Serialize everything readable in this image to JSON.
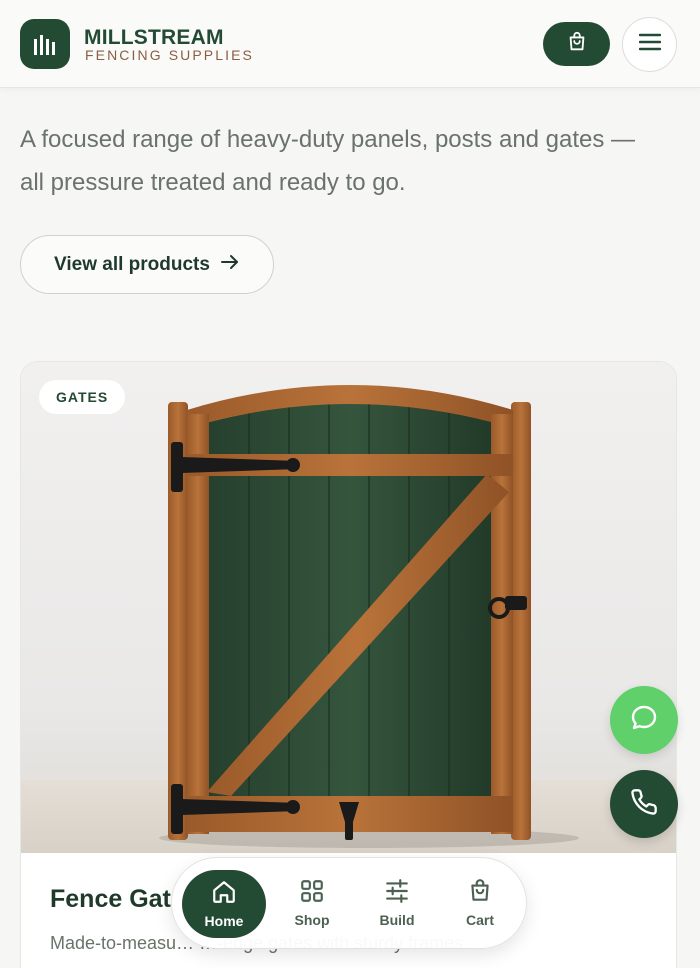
{
  "brand": {
    "name": "MILLSTREAM",
    "subtitle": "FENCING SUPPLIES"
  },
  "intro": {
    "text": "A focused range of heavy-duty panels, posts and gates — all pressure treated and ready to go.",
    "view_all_label": "View all products",
    "view_all_icon": "arrow-right-icon"
  },
  "product_card": {
    "tag": "GATES",
    "title": "Fence Gat",
    "description": "Made-to-measu… …-edge gates with sturdy frames.",
    "image": "wooden-fence-gate-image"
  },
  "floating_actions": {
    "chat_icon": "chat-bubble-icon",
    "phone_icon": "phone-icon"
  },
  "bottom_nav": {
    "items": [
      {
        "label": "Home",
        "icon": "home-icon",
        "active": true
      },
      {
        "label": "Shop",
        "icon": "grid-icon",
        "active": false
      },
      {
        "label": "Build",
        "icon": "sliders-icon",
        "active": false
      },
      {
        "label": "Cart",
        "icon": "shopping-bag-icon",
        "active": false
      }
    ]
  },
  "colors": {
    "primary": "#234a33",
    "accent_brown": "#8b5e44",
    "chat_green": "#5fd06a",
    "background": "#f6f6f5"
  }
}
